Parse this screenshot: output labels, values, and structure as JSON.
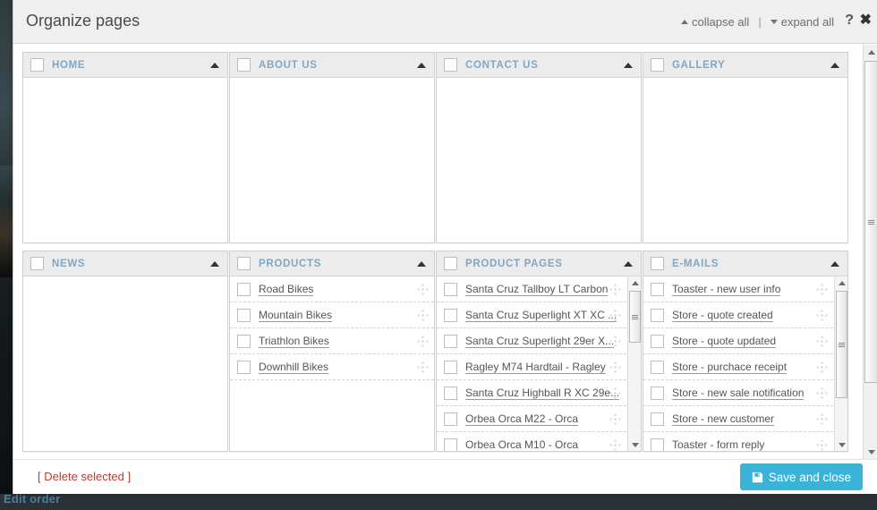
{
  "background": {
    "bottom_label": "Edit order"
  },
  "modal": {
    "title": "Organize pages",
    "collapse_all": "collapse all",
    "expand_all": "expand all",
    "separator": "|",
    "help_icon": "?",
    "close_icon": "✖"
  },
  "panels": [
    {
      "title": "HOME",
      "items": []
    },
    {
      "title": "ABOUT US",
      "items": []
    },
    {
      "title": "CONTACT US",
      "items": []
    },
    {
      "title": "GALLERY",
      "items": []
    },
    {
      "title": "NEWS",
      "items": []
    },
    {
      "title": "PRODUCTS",
      "items": [
        "Road Bikes",
        "Mountain Bikes",
        "Triathlon Bikes",
        "Downhill Bikes"
      ]
    },
    {
      "title": "PRODUCT PAGES",
      "items": [
        "Santa Cruz Tallboy LT Carbon",
        "Santa Cruz Superlight XT XC ...",
        "Santa Cruz Superlight 29er X...",
        "Ragley M74 Hardtail - Ragley",
        "Santa Cruz Highball R XC 29e...",
        "Orbea Orca M22 - Orca",
        "Orbea Orca M10 - Orca"
      ]
    },
    {
      "title": "E-MAILS",
      "items": [
        "Toaster - new user info",
        "Store - quote created",
        "Store - quote updated",
        "Store - purchace receipt",
        "Store - new sale notification",
        "Store - new customer",
        "Toaster - form reply"
      ]
    }
  ],
  "footer": {
    "delete_label": "[ Delete selected ]",
    "save_label": "Save and close"
  },
  "colors": {
    "panel_title": "#7fa7c4",
    "delete_link": "#c0392b",
    "save_button": "#39b3d7",
    "panel_header_bg": "#ececec"
  }
}
